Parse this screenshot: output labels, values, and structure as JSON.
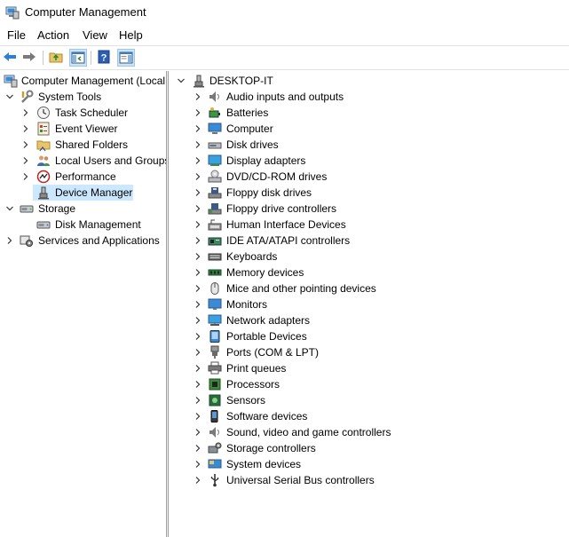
{
  "window": {
    "title": "Computer Management"
  },
  "menu": [
    "File",
    "Action",
    "View",
    "Help"
  ],
  "toolbar": {
    "buttons": [
      "back-icon",
      "forward-icon",
      "up-folder-icon",
      "show-hide-console-tree-icon",
      "help-icon",
      "show-action-pane-icon"
    ]
  },
  "tree": {
    "root": "Computer Management (Local",
    "system_tools": "System Tools",
    "task_scheduler": "Task Scheduler",
    "event_viewer": "Event Viewer",
    "shared_folders": "Shared Folders",
    "local_users": "Local Users and Groups",
    "performance": "Performance",
    "device_manager": "Device Manager",
    "storage": "Storage",
    "disk_management": "Disk Management",
    "services": "Services and Applications"
  },
  "devices": {
    "root": "DESKTOP-IT",
    "categories": [
      {
        "label": "Audio inputs and outputs",
        "icon": "speaker-icon"
      },
      {
        "label": "Batteries",
        "icon": "battery-icon"
      },
      {
        "label": "Computer",
        "icon": "computer-icon"
      },
      {
        "label": "Disk drives",
        "icon": "disk-drive-icon"
      },
      {
        "label": "Display adapters",
        "icon": "display-adapter-icon"
      },
      {
        "label": "DVD/CD-ROM drives",
        "icon": "dvd-icon"
      },
      {
        "label": "Floppy disk drives",
        "icon": "floppy-icon"
      },
      {
        "label": "Floppy drive controllers",
        "icon": "floppy-controller-icon"
      },
      {
        "label": "Human Interface Devices",
        "icon": "hid-icon"
      },
      {
        "label": "IDE ATA/ATAPI controllers",
        "icon": "ide-controller-icon"
      },
      {
        "label": "Keyboards",
        "icon": "keyboard-icon"
      },
      {
        "label": "Memory devices",
        "icon": "memory-icon"
      },
      {
        "label": "Mice and other pointing devices",
        "icon": "mouse-icon"
      },
      {
        "label": "Monitors",
        "icon": "monitor-icon"
      },
      {
        "label": "Network adapters",
        "icon": "network-adapter-icon"
      },
      {
        "label": "Portable Devices",
        "icon": "portable-device-icon"
      },
      {
        "label": "Ports (COM & LPT)",
        "icon": "port-icon"
      },
      {
        "label": "Print queues",
        "icon": "printer-icon"
      },
      {
        "label": "Processors",
        "icon": "processor-icon"
      },
      {
        "label": "Sensors",
        "icon": "sensor-icon"
      },
      {
        "label": "Software devices",
        "icon": "software-device-icon"
      },
      {
        "label": "Sound, video and game controllers",
        "icon": "sound-controller-icon"
      },
      {
        "label": "Storage controllers",
        "icon": "storage-controller-icon"
      },
      {
        "label": "System devices",
        "icon": "system-device-icon"
      },
      {
        "label": "Universal Serial Bus controllers",
        "icon": "usb-icon"
      }
    ]
  },
  "colors": {
    "selection": "#cce8ff",
    "accent": "#1e74c9"
  }
}
